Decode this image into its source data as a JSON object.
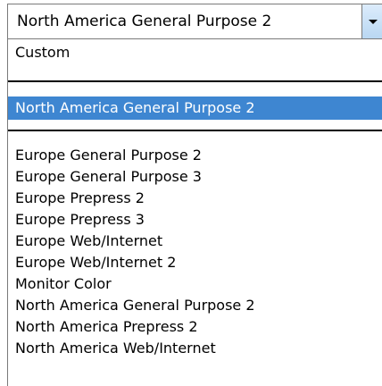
{
  "combo": {
    "value": "North America General Purpose 2",
    "arrow_icon": "chevron-down-icon"
  },
  "list": {
    "custom": "Custom",
    "selected": "North America General Purpose 2",
    "items": [
      "Europe General Purpose 2",
      "Europe General Purpose 3",
      "Europe Prepress 2",
      "Europe Prepress 3",
      "Europe Web/Internet",
      "Europe Web/Internet 2",
      "Monitor Color",
      "North America General Purpose 2",
      "North America Prepress 2",
      "North America Web/Internet"
    ]
  },
  "colors": {
    "highlight": "#3e86d1",
    "arrow_button": "#c9e1f7"
  }
}
